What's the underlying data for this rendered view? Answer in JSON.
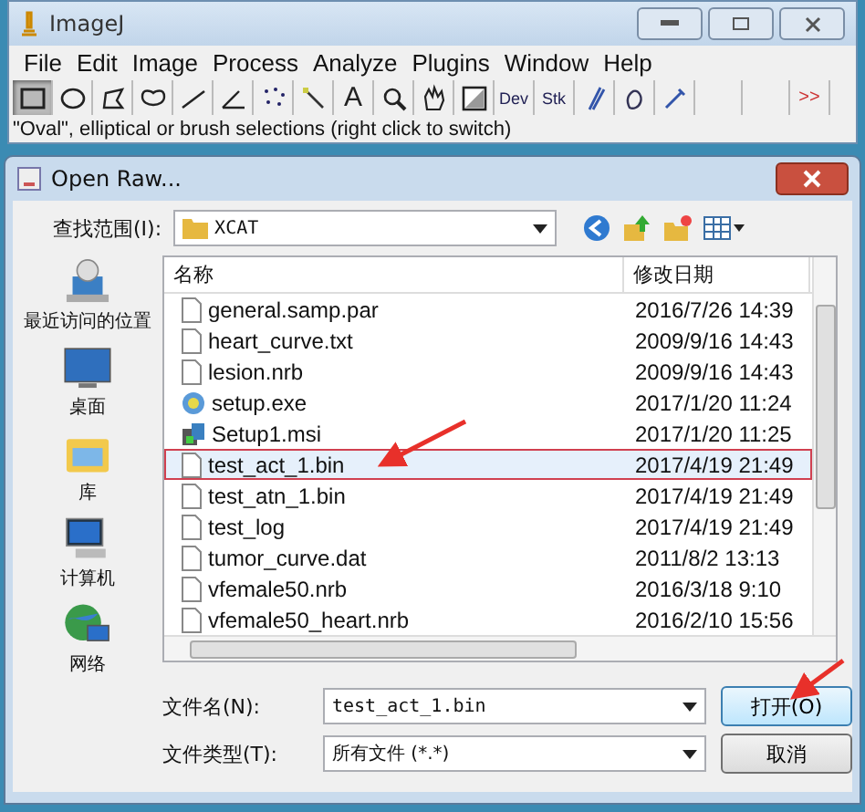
{
  "imagej": {
    "title": "ImageJ",
    "menu": [
      "File",
      "Edit",
      "Image",
      "Process",
      "Analyze",
      "Plugins",
      "Window",
      "Help"
    ],
    "tools": [
      {
        "kind": "icon",
        "selected": true
      },
      {
        "kind": "icon",
        "selected": false
      },
      {
        "kind": "icon",
        "selected": false
      },
      {
        "kind": "icon",
        "selected": false
      },
      {
        "kind": "icon",
        "selected": false
      },
      {
        "kind": "icon",
        "selected": false
      },
      {
        "kind": "icon",
        "selected": false
      },
      {
        "kind": "icon",
        "selected": false
      },
      {
        "kind": "text",
        "label": "A",
        "selected": false
      },
      {
        "kind": "icon",
        "selected": false
      },
      {
        "kind": "icon",
        "selected": false
      },
      {
        "kind": "icon",
        "selected": false
      },
      {
        "kind": "menu",
        "label": "Dev",
        "selected": false
      },
      {
        "kind": "menu",
        "label": "Stk",
        "selected": false
      },
      {
        "kind": "icon",
        "selected": false
      },
      {
        "kind": "icon",
        "selected": false
      },
      {
        "kind": "icon",
        "selected": false
      },
      {
        "kind": "blank",
        "selected": false
      },
      {
        "kind": "blank",
        "selected": false
      },
      {
        "kind": "more",
        "label": ">>",
        "selected": false
      }
    ],
    "status": "\"Oval\", elliptical or brush selections (right click to switch)"
  },
  "dialog": {
    "title": "Open Raw...",
    "look_in": {
      "label": "查找范围(I):",
      "value": "XCAT"
    },
    "places": [
      "最近访问的位置",
      "桌面",
      "库",
      "计算机",
      "网络"
    ],
    "columns": [
      "名称",
      "修改日期"
    ],
    "files": [
      {
        "name": "general.samp.par",
        "date": "2016/7/26 14:39",
        "kind": "file",
        "selected": false
      },
      {
        "name": "heart_curve.txt",
        "date": "2009/9/16 14:43",
        "kind": "file",
        "selected": false
      },
      {
        "name": "lesion.nrb",
        "date": "2009/9/16 14:43",
        "kind": "file",
        "selected": false
      },
      {
        "name": "setup.exe",
        "date": "2017/1/20 11:24",
        "kind": "setup",
        "selected": false
      },
      {
        "name": "Setup1.msi",
        "date": "2017/1/20 11:25",
        "kind": "installer",
        "selected": false
      },
      {
        "name": "test_act_1.bin",
        "date": "2017/4/19 21:49",
        "kind": "file",
        "selected": true
      },
      {
        "name": "test_atn_1.bin",
        "date": "2017/4/19 21:49",
        "kind": "file",
        "selected": false
      },
      {
        "name": "test_log",
        "date": "2017/4/19 21:49",
        "kind": "file",
        "selected": false
      },
      {
        "name": "tumor_curve.dat",
        "date": "2011/8/2 13:13",
        "kind": "file",
        "selected": false
      },
      {
        "name": "vfemale50.nrb",
        "date": "2016/3/18 9:10",
        "kind": "file",
        "selected": false
      },
      {
        "name": "vfemale50_heart.nrb",
        "date": "2016/2/10 15:56",
        "kind": "file",
        "selected": false
      }
    ],
    "file_name": {
      "label": "文件名(N):",
      "value": "test_act_1.bin"
    },
    "file_type": {
      "label": "文件类型(T):",
      "value": "所有文件 (*.*)"
    },
    "buttons": [
      "打开(O)",
      "取消"
    ]
  }
}
